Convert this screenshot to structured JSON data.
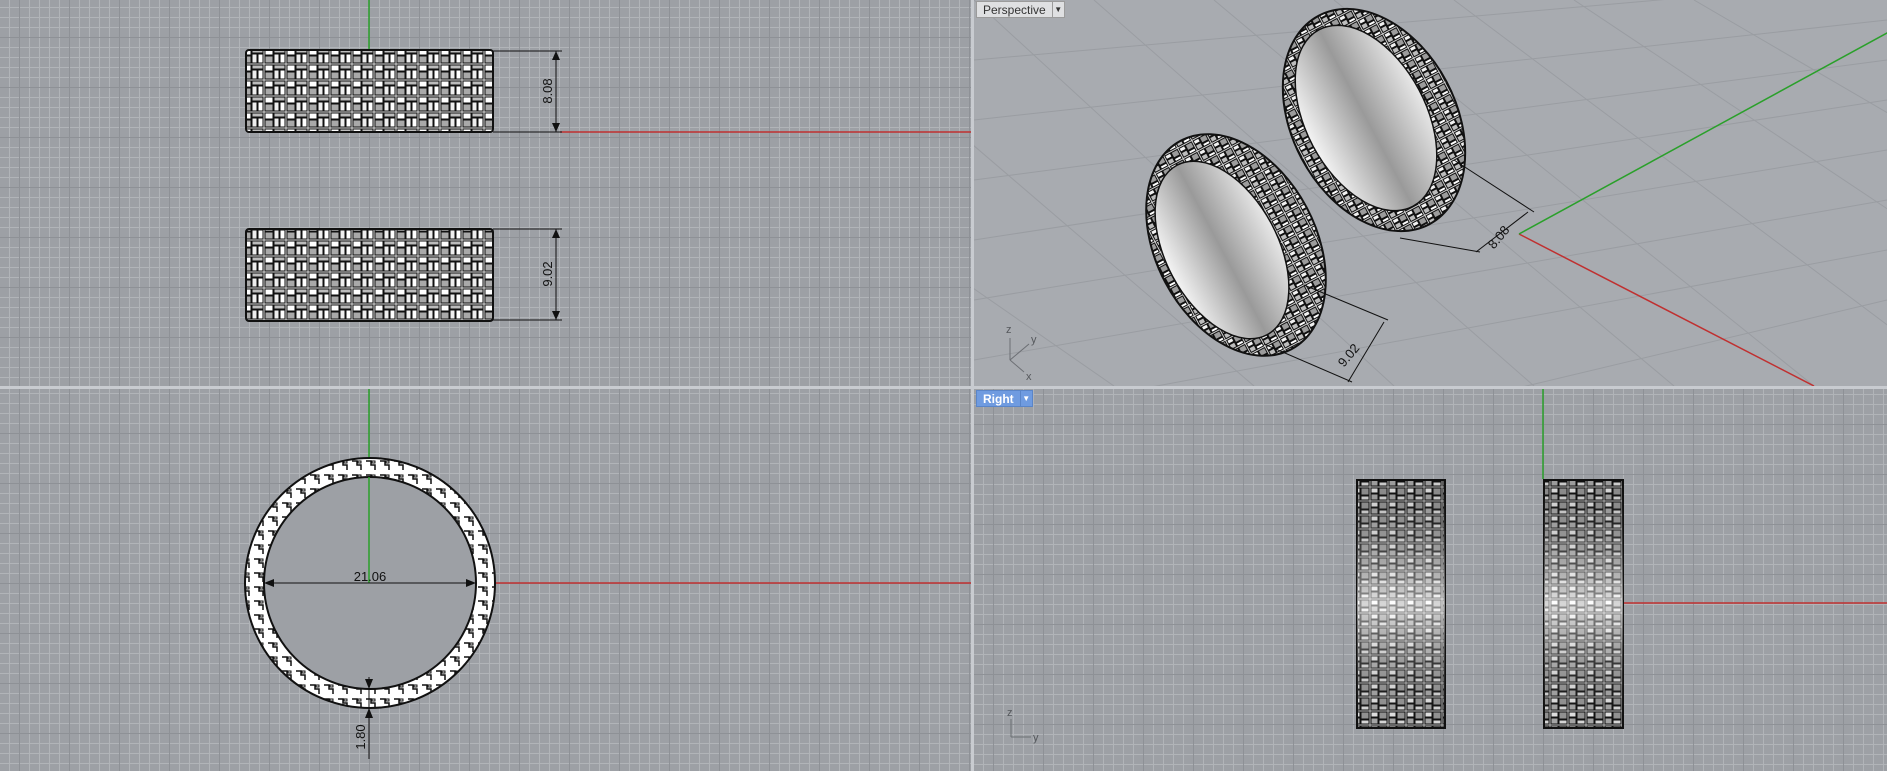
{
  "viewports": {
    "perspective": {
      "label": "Perspective"
    },
    "right": {
      "label": "Right"
    }
  },
  "dimensions": {
    "top_ring1_height": "8.08",
    "top_ring2_height": "9.02",
    "front_diameter": "21.06",
    "front_thickness": "1.80",
    "persp_ring1": "8.08",
    "persp_ring2": "9.02"
  },
  "axis_labels": {
    "persp_x": "x",
    "persp_y": "y",
    "persp_z": "z",
    "right_y": "y",
    "right_z": "z"
  },
  "colors": {
    "x_axis": "#c03030",
    "y_axis": "#2aa02a",
    "active_viewport": "#6f9be0"
  }
}
